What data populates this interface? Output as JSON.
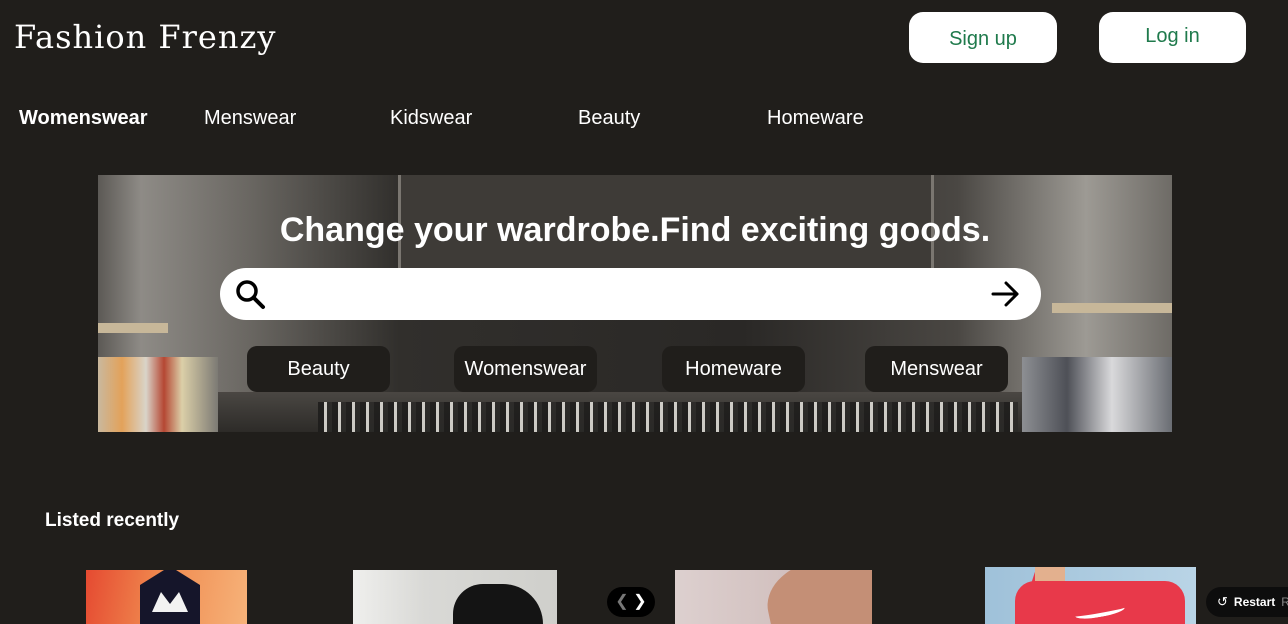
{
  "brand": {
    "logo": "Fashion Frenzy"
  },
  "header": {
    "signup_label": "Sign up",
    "login_label": "Log in"
  },
  "nav": {
    "items": [
      {
        "label": "Womenswear",
        "active": true
      },
      {
        "label": "Menswear",
        "active": false
      },
      {
        "label": "Kidswear",
        "active": false
      },
      {
        "label": "Beauty",
        "active": false
      },
      {
        "label": "Homeware",
        "active": false
      }
    ]
  },
  "hero": {
    "title": "Change your wardrobe.Find exciting goods.",
    "search": {
      "placeholder": "",
      "value": ""
    },
    "icons": {
      "search": "search-icon",
      "submit": "arrow-right-icon"
    },
    "chips": [
      {
        "label": "Beauty"
      },
      {
        "label": "Womenswear"
      },
      {
        "label": "Homeware"
      },
      {
        "label": "Menswear"
      }
    ]
  },
  "listed_recently": {
    "title": "Listed recently",
    "carousel": {
      "prev_icon": "chevron-left-icon",
      "next_icon": "chevron-right-icon"
    }
  },
  "prototype_controls": {
    "restart_label": "Restart",
    "restart_extra": "R",
    "restart_icon": "restart-icon"
  },
  "colors": {
    "background": "#201e1b",
    "accent": "#1f7a4c",
    "chip_bg": "#201e1b"
  }
}
